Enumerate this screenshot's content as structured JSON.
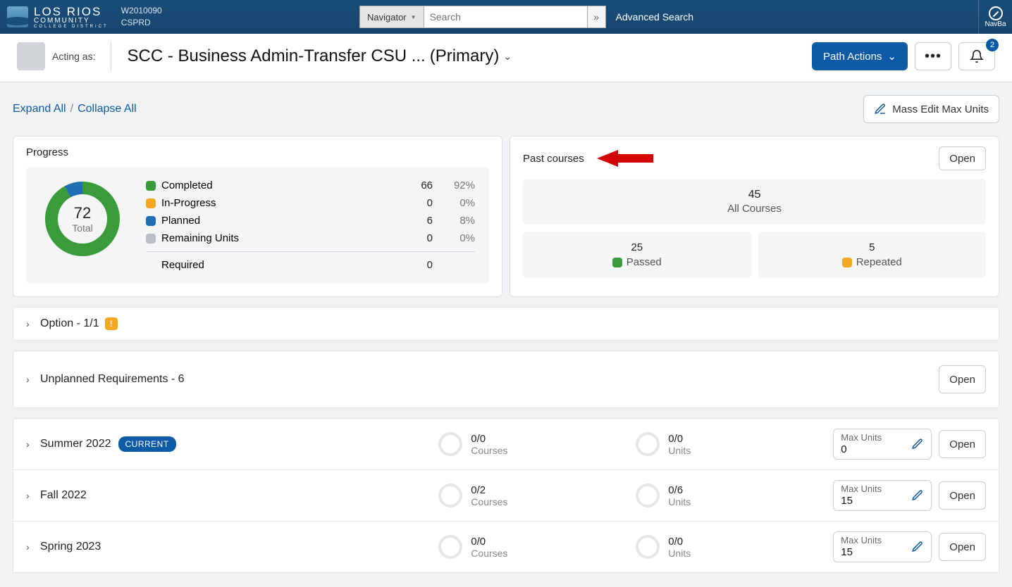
{
  "topbar": {
    "logo_l1": "LOS RIOS",
    "logo_l2": "COMMUNITY",
    "logo_l3": "COLLEGE DISTRICT",
    "env_code": "W2010090",
    "env_db": "CSPRD",
    "navigator_label": "Navigator",
    "search_placeholder": "Search",
    "search_go_icon": "»",
    "adv_search": "Advanced Search",
    "navbar_label": "NavBa"
  },
  "header": {
    "acting_as": "Acting as:",
    "title_main": "SCC - Business Admin-Transfer CSU ...",
    "title_suffix": "(Primary)",
    "path_actions": "Path Actions",
    "notif_count": "2"
  },
  "toolbar": {
    "expand_all": "Expand All",
    "collapse_all": "Collapse All",
    "mass_edit": "Mass Edit Max Units"
  },
  "progress_card": {
    "title": "Progress",
    "total_value": "72",
    "total_label": "Total",
    "rows": {
      "completed": {
        "label": "Completed",
        "value": "66",
        "pct": "92%"
      },
      "inprogress": {
        "label": "In-Progress",
        "value": "0",
        "pct": "0%"
      },
      "planned": {
        "label": "Planned",
        "value": "6",
        "pct": "8%"
      },
      "remaining": {
        "label": "Remaining Units",
        "value": "0",
        "pct": "0%"
      },
      "required": {
        "label": "Required",
        "value": "0"
      }
    }
  },
  "past_card": {
    "title": "Past courses",
    "open": "Open",
    "all_count": "45",
    "all_label": "All Courses",
    "passed_count": "25",
    "passed_label": "Passed",
    "repeated_count": "5",
    "repeated_label": "Repeated"
  },
  "sections": {
    "option": {
      "title": "Option - 1/1"
    },
    "unplanned": {
      "title": "Unplanned Requirements - 6",
      "open": "Open"
    }
  },
  "terms": {
    "summer22": {
      "name": "Summer 2022",
      "current": "CURRENT",
      "courses_v": "0/0",
      "courses_l": "Courses",
      "units_v": "0/0",
      "units_l": "Units",
      "max_label": "Max Units",
      "max_val": "0",
      "open": "Open"
    },
    "fall22": {
      "name": "Fall 2022",
      "courses_v": "0/2",
      "courses_l": "Courses",
      "units_v": "0/6",
      "units_l": "Units",
      "max_label": "Max Units",
      "max_val": "15",
      "open": "Open"
    },
    "spring23": {
      "name": "Spring 2023",
      "courses_v": "0/0",
      "courses_l": "Courses",
      "units_v": "0/0",
      "units_l": "Units",
      "max_label": "Max Units",
      "max_val": "15",
      "open": "Open"
    }
  },
  "colors": {
    "completed": "#3a9b3a",
    "inprogress": "#f5a623",
    "planned": "#1f6fb2",
    "remaining": "#b8bec4",
    "passed": "#3a9b3a",
    "repeated": "#f5a623"
  },
  "chart_data": {
    "type": "pie",
    "title": "Progress",
    "total": 72,
    "series": [
      {
        "name": "Completed",
        "value": 66,
        "pct": 92
      },
      {
        "name": "In-Progress",
        "value": 0,
        "pct": 0
      },
      {
        "name": "Planned",
        "value": 6,
        "pct": 8
      },
      {
        "name": "Remaining Units",
        "value": 0,
        "pct": 0
      }
    ]
  }
}
